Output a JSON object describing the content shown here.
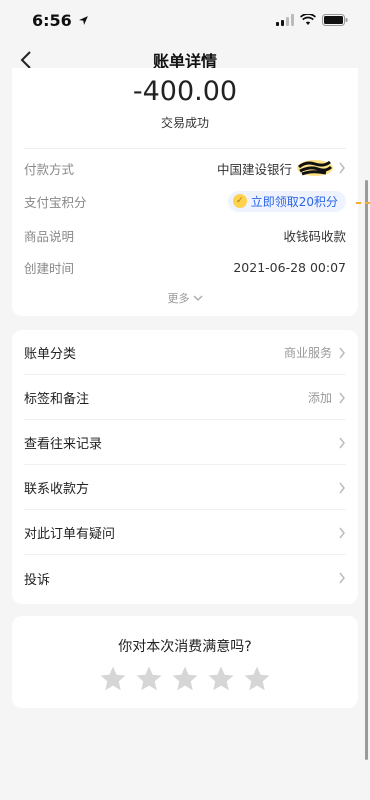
{
  "status_bar": {
    "time": "6:56"
  },
  "nav": {
    "title": "账单详情"
  },
  "transaction": {
    "amount": "-400.00",
    "status": "交易成功"
  },
  "details": [
    {
      "label": "付款方式",
      "value": "中国建设银行"
    },
    {
      "label": "支付宝积分",
      "value": "立即领取20积分"
    },
    {
      "label": "商品说明",
      "value": "收钱码收款"
    },
    {
      "label": "创建时间",
      "value": "2021-06-28 00:07"
    }
  ],
  "more_label": "更多",
  "menu": [
    {
      "label": "账单分类",
      "value": "商业服务"
    },
    {
      "label": "标签和备注",
      "value": "添加"
    },
    {
      "label": "查看往来记录",
      "value": ""
    },
    {
      "label": "联系收款方",
      "value": ""
    },
    {
      "label": "对此订单有疑问",
      "value": ""
    },
    {
      "label": "投诉",
      "value": ""
    }
  ],
  "survey": {
    "question": "你对本次消费满意吗?",
    "rating": 0,
    "max_rating": 5
  },
  "colors": {
    "accent": "#2b66e8",
    "star": "#d6d6d6",
    "background": "#f5f5f5"
  },
  "icons": [
    "location-arrow-icon",
    "signal-icon",
    "wifi-icon",
    "battery-icon",
    "back-chevron-icon",
    "chevron-right-icon",
    "chevron-down-icon",
    "coin-icon",
    "star-icon"
  ]
}
